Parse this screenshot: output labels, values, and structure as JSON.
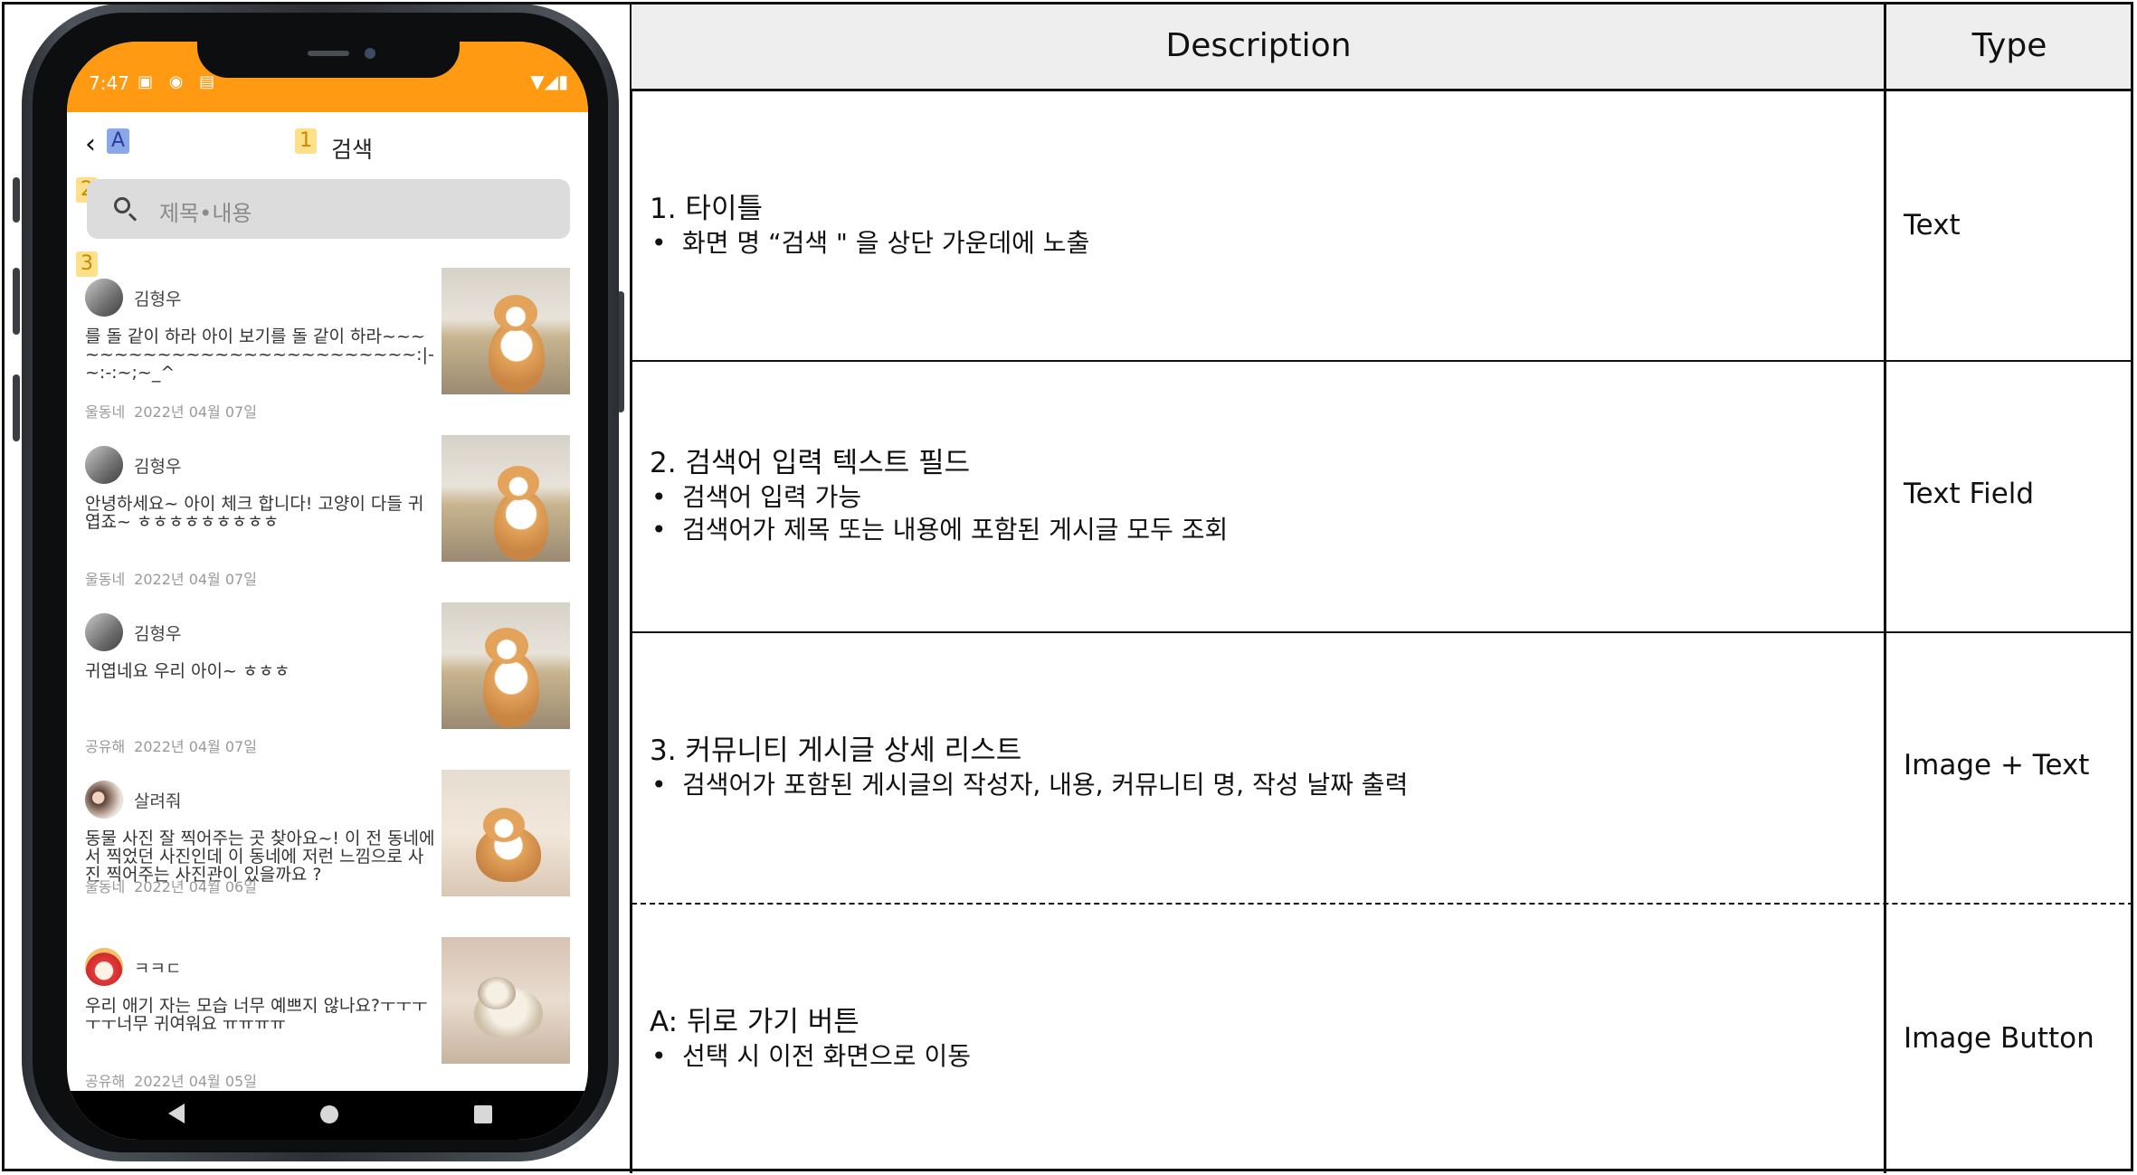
{
  "phone": {
    "status_time": "7:47",
    "status_left_icons": "▣ ◉ ▤",
    "status_right_icons": "▼◢▮",
    "back_tag": "A",
    "title_tag": "1",
    "title": "검색",
    "search_tag": "2",
    "search_placeholder": "제목•내용",
    "list_tag": "3",
    "posts": [
      {
        "author": "김형우",
        "content": "를 돌 같이 하라 아이 보기를 돌 같이 하라~~~~~~~~~~~~~~~~~~~~~~~~~~:|-~:-:~;~_^",
        "community": "울동네",
        "date": "2022년 04월 07일"
      },
      {
        "author": "김형우",
        "content": "안녕하세요~ 아이 체크 합니다! 고양이 다들 귀엽죠~ ㅎㅎㅎㅎㅎㅎㅎㅎㅎ",
        "community": "울동네",
        "date": "2022년 04월 07일"
      },
      {
        "author": "김형우",
        "content": "귀엽네요 우리 아이~ ㅎㅎㅎ",
        "community": "공유해",
        "date": "2022년 04월 07일"
      },
      {
        "author": "살려줘",
        "content": "동물 사진 잘 찍어주는 곳 찾아요~! 이 전 동네에서 찍었던 사진인데 이 동네에 저런 느낌으로 사진 찍어주는 사진관이 있을까요 ?",
        "community": "울동네",
        "date": "2022년 04월 06일"
      },
      {
        "author": "ㅋㅋㄷ",
        "content": "우리 애기 자는 모습 너무 예쁘지 않나요?ㅜㅜㅜㅜㅜ너무 귀여워요 ㅠㅠㅠㅠ",
        "community": "공유해",
        "date": "2022년 04월 05일"
      }
    ]
  },
  "table": {
    "header_description": "Description",
    "header_type": "Type",
    "rows": [
      {
        "title": "1.  타이틀",
        "bullets": [
          "화면 명 “검색 \" 을 상단 가운데에 노출"
        ],
        "type": "Text"
      },
      {
        "title": "2.  검색어 입력 텍스트 필드",
        "bullets": [
          "검색어 입력 가능",
          "검색어가 제목 또는 내용에 포함된 게시글 모두 조회"
        ],
        "type": "Text Field"
      },
      {
        "title": "3.  커뮤니티 게시글 상세 리스트",
        "bullets": [
          "검색어가 포함된 게시글의 작성자, 내용, 커뮤니티 명, 작성 날짜 출력"
        ],
        "type": "Image + Text"
      },
      {
        "title": "A: 뒤로 가기 버튼",
        "bullets": [
          "선택 시 이전 화면으로 이동"
        ],
        "type": "Image Button"
      }
    ]
  },
  "colors": {
    "status_bar": "#ff9a12",
    "tag_yellow": "#ffe08a",
    "tag_blue": "#8aa8e8"
  },
  "icons": [
    "back-arrow-icon",
    "search-icon",
    "nav-back-icon",
    "nav-home-icon",
    "nav-recent-icon"
  ]
}
